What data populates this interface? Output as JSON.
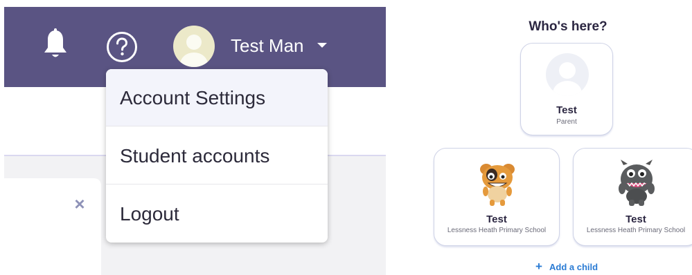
{
  "header": {
    "user_name": "Test Man",
    "icons": [
      "bell-icon",
      "help-icon",
      "avatar",
      "caret-down-icon"
    ]
  },
  "dropdown": {
    "items": [
      {
        "label": "Account Settings"
      },
      {
        "label": "Student accounts"
      },
      {
        "label": "Logout"
      }
    ]
  },
  "dialog": {
    "close_symbol": "×"
  },
  "profiles": {
    "title": "Who's here?",
    "parent": {
      "name": "Test",
      "role": "Parent"
    },
    "children": [
      {
        "name": "Test",
        "school": "Lessness Heath Primary School",
        "avatar": "monster-orange"
      },
      {
        "name": "Test",
        "school": "Lessness Heath Primary School",
        "avatar": "monster-grey"
      }
    ],
    "add_child_label": "Add a child",
    "add_child_icon": "+"
  },
  "colors": {
    "header_bg": "#5a5483",
    "link_blue": "#2a7bd4",
    "text_dark": "#2b2641"
  }
}
